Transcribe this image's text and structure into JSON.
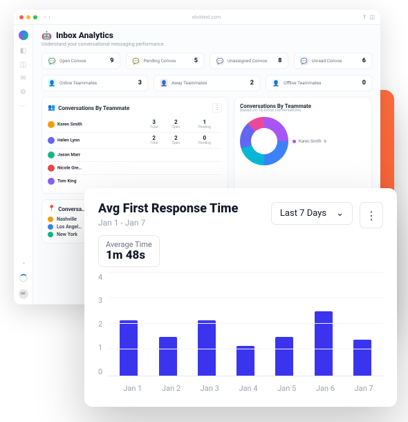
{
  "browser": {
    "url": "slicktext.com",
    "avatar_label": "ME"
  },
  "page": {
    "title": "Inbox Analytics",
    "subtitle": "Understand your conversational messaging performance."
  },
  "stats_row1": [
    {
      "label": "Open Convos",
      "value": "9",
      "cls": "bg-green",
      "ic": "💬"
    },
    {
      "label": "Pending Convos",
      "value": "5",
      "cls": "bg-amber",
      "ic": "💬"
    },
    {
      "label": "Unassigned Convos",
      "value": "8",
      "cls": "bg-violet",
      "ic": "💬"
    },
    {
      "label": "Unread Convos",
      "value": "6",
      "cls": "bg-blue",
      "ic": "💬"
    }
  ],
  "stats_row2": [
    {
      "label": "Online Teammates",
      "value": "3",
      "cls": "bg-teal",
      "ic": "👤"
    },
    {
      "label": "Away Teammates",
      "value": "2",
      "cls": "bg-red",
      "ic": "👤"
    },
    {
      "label": "Offline Teammates",
      "value": "0",
      "cls": "bg-gray",
      "ic": "👤"
    }
  ],
  "teammates_panel": {
    "title": "Conversations By Teammate",
    "cols": [
      "Total",
      "Open",
      "Pending"
    ],
    "rows": [
      {
        "name": "Karen Smith",
        "av": "#f59e0b",
        "vals": [
          "3",
          "2",
          "1"
        ]
      },
      {
        "name": "Helen Lynn",
        "av": "#6366f1",
        "vals": [
          "2",
          "2",
          "0"
        ]
      },
      {
        "name": "Jason Marr",
        "av": "#10b981",
        "vals": [
          "",
          "",
          ""
        ]
      },
      {
        "name": "Nicole Gre…",
        "av": "#ef4444",
        "vals": [
          "",
          "",
          ""
        ]
      },
      {
        "name": "Tom King",
        "av": "#8b5cf6",
        "vals": [
          "",
          "",
          ""
        ]
      }
    ]
  },
  "donut_panel": {
    "title": "Conversations By Teammate",
    "subtitle": "Based on 16 inbox conversations.",
    "colors": [
      "#a855f7",
      "#3b82f6",
      "#06b6d4",
      "#6366f1",
      "#ec4899"
    ],
    "legend": {
      "label": "Karen Smith",
      "value": "6",
      "color": "#a855f7"
    }
  },
  "geo_panel": {
    "title": "Conversa…",
    "items": [
      {
        "name": "Nashville",
        "color": "#f59e0b"
      },
      {
        "name": "Los Angel…",
        "color": "#3b82f6"
      },
      {
        "name": "New York",
        "color": "#10b981"
      }
    ]
  },
  "fg": {
    "title": "Avg First Response Time",
    "range": "Jan 1 - Jan 7",
    "dropdown": "Last 7 Days",
    "avg_label": "Average Time",
    "avg_value": "1m 48s"
  },
  "chart_data": {
    "type": "bar",
    "title": "Avg First Response Time",
    "xlabel": "",
    "ylabel": "",
    "ylim": [
      0,
      4
    ],
    "yticks": [
      0,
      1,
      2,
      3,
      4
    ],
    "categories": [
      "Jan 1",
      "Jan 2",
      "Jan 3",
      "Jan 4",
      "Jan 5",
      "Jan 6",
      "Jan 7"
    ],
    "values": [
      2.15,
      1.5,
      2.15,
      1.15,
      1.5,
      2.5,
      1.4
    ]
  }
}
